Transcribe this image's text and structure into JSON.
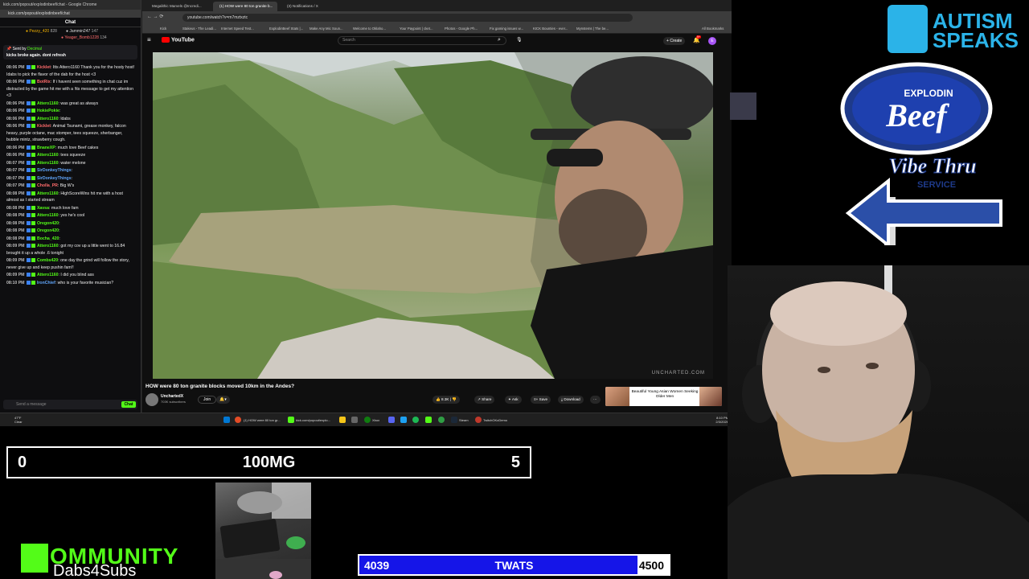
{
  "chat_window": {
    "title": "kick.com/popout/explodinbeef/chat - Google Chrome",
    "url": "kick.com/popout/explodinbeef/chat",
    "header": "Chat",
    "gifters": [
      {
        "name": "Pezzy_420",
        "count": "828"
      },
      {
        "name": "Jammin247",
        "count": "147"
      },
      {
        "name": "Yeager_Bomb1228",
        "count": "134"
      }
    ],
    "pinned": {
      "label": "Sent by",
      "user": "Decimal",
      "message": "kicks broke again. dont refresh"
    },
    "messages": [
      {
        "time": "08:06 PM",
        "user": "Kicklet",
        "color": "#ff6b6b",
        "text": "Itts Attero1160 Thank you for the hosty host! Idabs to pick the flavor of the dab for the host <3"
      },
      {
        "time": "08:06 PM",
        "user": "BotRix",
        "color": "#ff6b6b",
        "text": "If i havent seen something in chat cuz im distracted by the game hit me with a !tts message to get my attention <3"
      },
      {
        "time": "08:06 PM",
        "user": "Attero1160",
        "color": "#53fc18",
        "text": "was great as always"
      },
      {
        "time": "08:06 PM",
        "user": "HokiePokie",
        "color": "#53fc18",
        "text": ""
      },
      {
        "time": "08:06 PM",
        "user": "Attero1160",
        "color": "#53fc18",
        "text": "ldabs"
      },
      {
        "time": "08:06 PM",
        "user": "Kicklet",
        "color": "#ff6b6b",
        "text": "Animal Tsunami, grease monkey, falcon heavy, purple octane, mac stomper, tees squeeze, sherbanger, bubble mintz, strawberry cough."
      },
      {
        "time": "08:06 PM",
        "user": "BnaneXP",
        "color": "#53fc18",
        "text": "much love Beef cakes"
      },
      {
        "time": "08:06 PM",
        "user": "Attero1160",
        "color": "#53fc18",
        "text": "tees squeeze"
      },
      {
        "time": "08:07 PM",
        "user": "Attero1160",
        "color": "#53fc18",
        "text": "water melone"
      },
      {
        "time": "08:07 PM",
        "user": "SirDonkeyThings",
        "color": "#60a5fa",
        "text": ""
      },
      {
        "time": "08:07 PM",
        "user": "SirDonkeyThings",
        "color": "#60a5fa",
        "text": ""
      },
      {
        "time": "08:07 PM",
        "user": "Cholla_PR",
        "color": "#ff6b6b",
        "text": "Big W's"
      },
      {
        "time": "08:08 PM",
        "user": "Attero1160",
        "color": "#53fc18",
        "text": "HighScoreWins hit me with a host almost as I started stream"
      },
      {
        "time": "08:08 PM",
        "user": "Xavsa",
        "color": "#53fc18",
        "text": "much love fam"
      },
      {
        "time": "08:08 PM",
        "user": "Attero1160",
        "color": "#53fc18",
        "text": "yes he's cool"
      },
      {
        "time": "08:08 PM",
        "user": "Oregon420",
        "color": "#53fc18",
        "text": ""
      },
      {
        "time": "08:08 PM",
        "user": "Oregon420",
        "color": "#53fc18",
        "text": ""
      },
      {
        "time": "08:08 PM",
        "user": "Bocha_420",
        "color": "#53fc18",
        "text": ""
      },
      {
        "time": "08:09 PM",
        "user": "Attero1160",
        "color": "#53fc18",
        "text": "got my cov up a little went to 16.84 brought it up a whole .6 tonight"
      },
      {
        "time": "08:09 PM",
        "user": "Combs420",
        "color": "#53fc18",
        "text": "one day the grind will follow the story, never give up and keep pushin fam!!"
      },
      {
        "time": "08:09 PM",
        "user": "Attero1160",
        "color": "#53fc18",
        "text": "I did you blind ass"
      },
      {
        "time": "08:10 PM",
        "user": "IronChief",
        "color": "#60a5fa",
        "text": "who is your favorite musician?"
      }
    ],
    "input_placeholder": "Send a message",
    "send_label": "Chat"
  },
  "browser": {
    "tabs": [
      {
        "label": "Megalithic Marvels @Incredi..."
      },
      {
        "label": "(1) HOW were 80 ton granite b..."
      },
      {
        "label": "(3) Notifications / X"
      }
    ],
    "url": "youtube.com/watch?v=m7mztxztc",
    "bookmarks": [
      "Kick",
      "Stakeus - The Leadi...",
      "Internet Speed Test...",
      "ExplodinBeef Stats |...",
      "Make Any Mic Soun...",
      "Welcome to Oklaho...",
      "Your Paypoint | cket...",
      "Photos - Google Ph...",
      "Fix gaming issues w...",
      "KICK Bounties - ever...",
      "Mynstems | The be...",
      "All Bookmarks"
    ],
    "search_placeholder": "Search",
    "create_label": "Create",
    "notif_count": "9+",
    "avatar_letter": "E",
    "video_title": "HOW were 80 ton granite blocks moved 10km in the Andes?",
    "channel_name": "UnchartedX",
    "channel_subs": "703K subscribers",
    "join_label": "Join",
    "like_count": "8.3K",
    "share_label": "Share",
    "ask_label": "Ask",
    "save_label": "Save",
    "download_label": "Download",
    "ad_text": "Beautiful Young Asian Women Seeking Older Men",
    "watermark": "UNCHARTED.COM",
    "yt_logo": "YouTube"
  },
  "taskbar": {
    "weather_temp": "47°F",
    "weather_desc": "Clear",
    "items": [
      {
        "label": "(1) HOW were 80 ton gr..."
      },
      {
        "label": "kick.com/popout/explo..."
      },
      {
        "label": "Xbox"
      },
      {
        "label": "Steam"
      },
      {
        "label": "TwitchOKoDemo"
      }
    ],
    "time": "8:10 PM",
    "date": "2/3/2026"
  },
  "overlay": {
    "autism_speaks": "AUTISM SPEAKS",
    "sign_top": "EXPLODIN",
    "sign_beef": "Beef",
    "sign_vibe": "Vibe Thru",
    "sign_service": "SERVICE",
    "score_left": "0",
    "score_title": "100MG",
    "score_right": "5",
    "kommunity_title": "OMMUNITY",
    "kommunity_sub": "Dabs4Subs",
    "goal": {
      "current": "4039",
      "name": "TWATS",
      "max": "4500",
      "progress": 0.8976
    }
  },
  "colors": {
    "kick_green": "#53fc18",
    "goal_blue": "#1515e8",
    "autism_blue": "#2bb3e8",
    "yt_red": "#ff0000"
  }
}
